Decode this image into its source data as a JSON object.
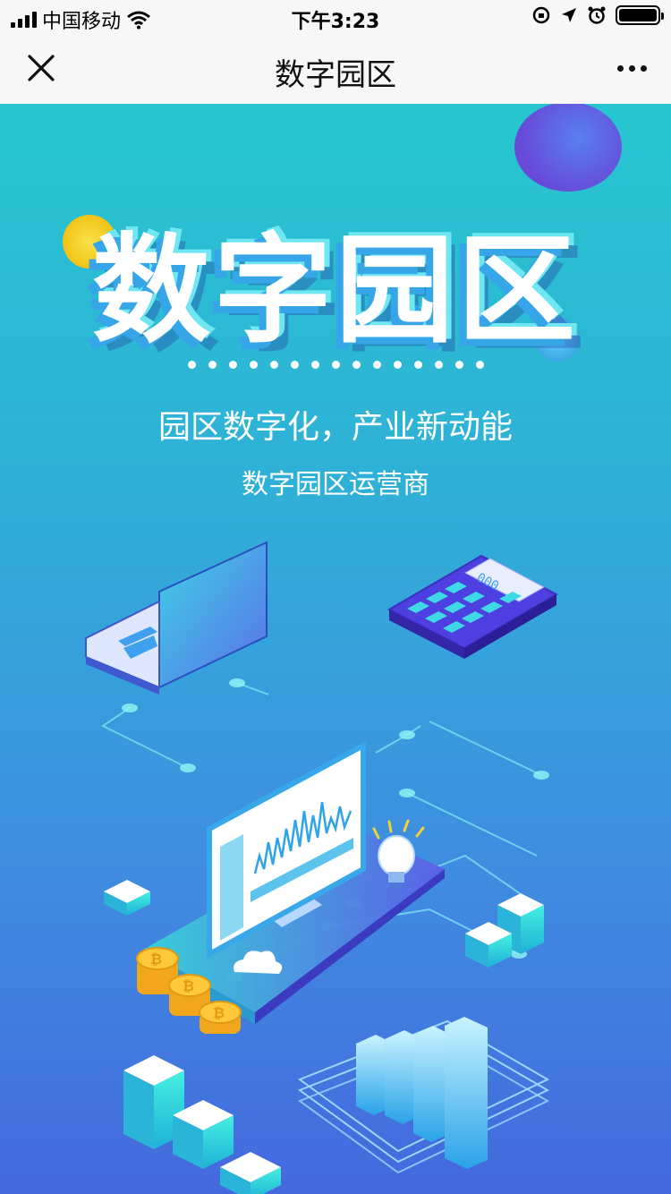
{
  "status_bar": {
    "carrier": "中国移动",
    "time": "下午3:23"
  },
  "nav": {
    "title": "数字园区",
    "close_icon": "close-icon",
    "more_icon": "more-icon"
  },
  "hero": {
    "title": "数字园区",
    "subtitle": "园区数字化，产业新动能",
    "tagline": "数字园区运营商"
  },
  "calculator": {
    "display": "000"
  },
  "colors": {
    "gradient_top": "#27c6cf",
    "gradient_bottom": "#4469de",
    "coin": "#f5b821",
    "accent": "#39e3e8"
  }
}
